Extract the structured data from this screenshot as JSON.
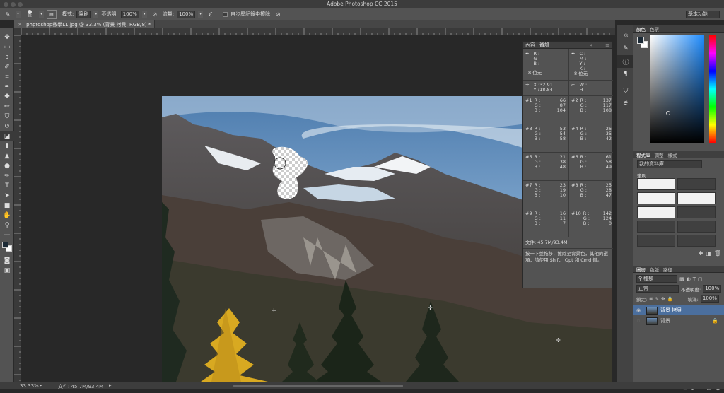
{
  "app": {
    "title": "Adobe Photoshop CC 2015",
    "workspace": "基本功能"
  },
  "options": {
    "brush_size": "35",
    "mode_label": "模式:",
    "mode_value": "筆刷",
    "opacity_label": "不透明:",
    "opacity_value": "100%",
    "flow_label": "流量:",
    "flow_value": "100%",
    "erase_history_label": "自步歷記錄中擦除"
  },
  "doc_tab": {
    "title": "phptoshop教學L1.jpg @ 33.3% (背景 拷貝, RGB/8) *"
  },
  "status": {
    "zoom": "33.33%",
    "doc_size": "文件: 45.7M/93.4M"
  },
  "info_panel": {
    "tabs": [
      "內容",
      "資訊"
    ],
    "rgb": {
      "r": "R :",
      "g": "G :",
      "b": "B :"
    },
    "cmyk": {
      "c": "C :",
      "m": "M :",
      "y": "Y :",
      "k": "K :"
    },
    "bits_left": "8 位元",
    "bits_right": "8 位元",
    "x_label": "X :",
    "x_value": "32.91",
    "y_label": "Y :",
    "y_value": "18.84",
    "w_label": "W :",
    "h_label": "H :",
    "samplers": [
      {
        "id": "#1",
        "r": "66",
        "g": "87",
        "b": "104"
      },
      {
        "id": "#2",
        "r": "137",
        "g": "117",
        "b": "108"
      },
      {
        "id": "#3",
        "r": "53",
        "g": "54",
        "b": "58"
      },
      {
        "id": "#4",
        "r": "26",
        "g": "35",
        "b": "42"
      },
      {
        "id": "#5",
        "r": "21",
        "g": "38",
        "b": "48"
      },
      {
        "id": "#6",
        "r": "61",
        "g": "58",
        "b": "49"
      },
      {
        "id": "#7",
        "r": "23",
        "g": "19",
        "b": "10"
      },
      {
        "id": "#8",
        "r": "25",
        "g": "28",
        "b": "47"
      },
      {
        "id": "#9",
        "r": "16",
        "g": "11",
        "b": "7"
      },
      {
        "id": "#10",
        "r": "142",
        "g": "124",
        "b": "0"
      }
    ],
    "doc": "文件: 45.7M/93.4M",
    "hint": "按一下並拖移，擦除至背景色，其他的選項，請使用 Shift、Opt 和 Cmd 鍵。"
  },
  "color_panel": {
    "tabs": [
      "顏色",
      "色票"
    ]
  },
  "library_panel": {
    "tabs": [
      "程式庫",
      "調整",
      "樣式"
    ],
    "select": "我的資料庫",
    "section": "筆刷"
  },
  "layers_panel": {
    "tabs": [
      "圖層",
      "色版",
      "路徑"
    ],
    "filter": "種類",
    "blend": "正常",
    "opacity_label": "不透明度:",
    "opacity_value": "100%",
    "lock_label": "鎖定:",
    "fill_label": "填滿:",
    "fill_value": "100%",
    "layers": [
      {
        "name": "背景 拷貝",
        "selected": true
      },
      {
        "name": "背景",
        "selected": false
      }
    ]
  },
  "colors": {
    "accent": "#4b6f9e",
    "panel": "#535353",
    "dark": "#282828"
  }
}
